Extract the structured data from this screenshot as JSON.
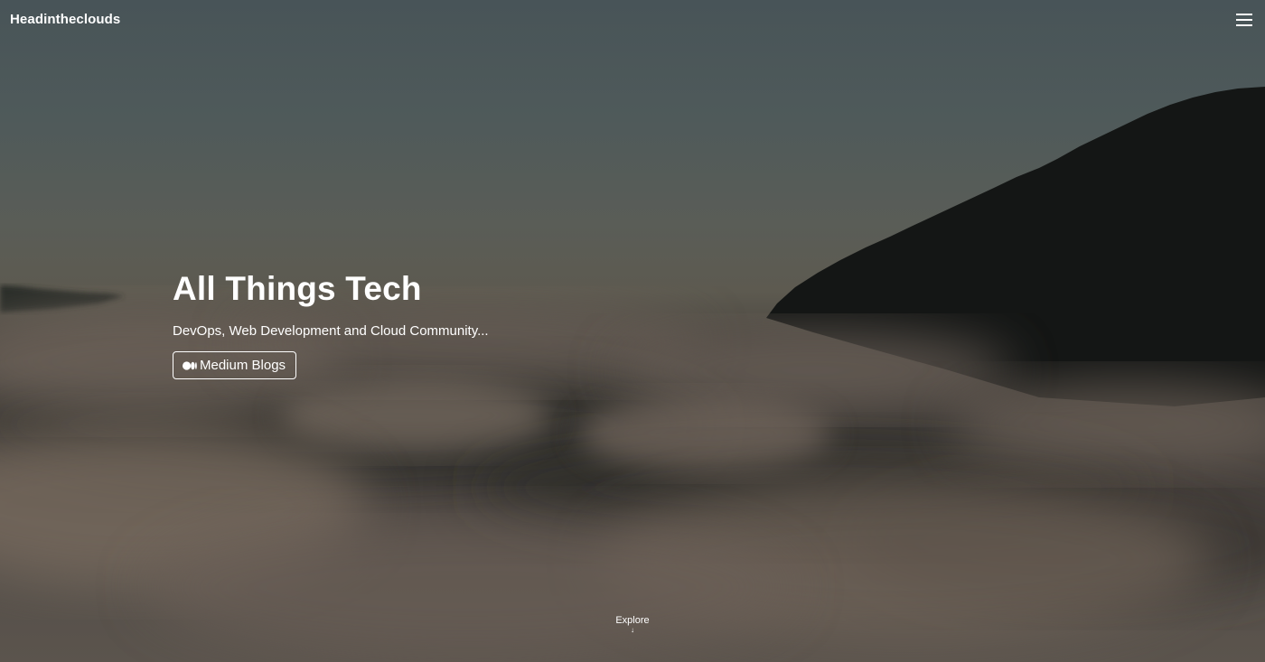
{
  "navbar": {
    "brand": "Headintheclouds",
    "menu_icon": "hamburger-menu-icon"
  },
  "hero": {
    "title": "All Things Tech",
    "subtitle": "DevOps, Web Development and Cloud Community...",
    "cta": {
      "label": "Medium Blogs",
      "icon": "medium-logo-icon"
    },
    "explore": {
      "label": "Explore",
      "icon": "arrow-down-icon",
      "arrow": "↓"
    }
  },
  "colors": {
    "text": "#ffffff",
    "sky_top": "#485458",
    "mountain": "#141615",
    "cloud": "#6a5f56"
  }
}
